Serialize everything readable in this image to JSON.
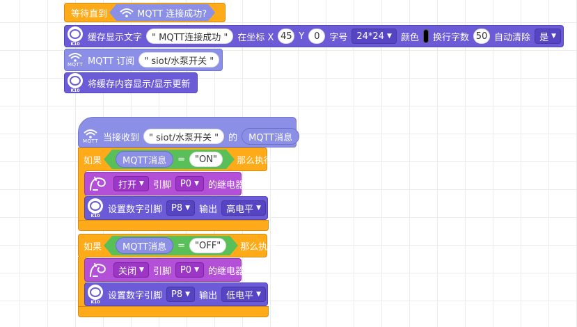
{
  "block_wait": {
    "label": "等待直到",
    "condition": "MQTT 连接成功?"
  },
  "block_cache_text": {
    "label": "缓存显示文字",
    "text": "\" MQTT连接成功 \"",
    "coord_label": "在坐标 X",
    "x": "45",
    "y_label": "Y",
    "y": "0",
    "size_label": "字号",
    "size": "24*24",
    "color_label": "颜色",
    "wrap_label": "换行字数",
    "wrap": "50",
    "autoclear_label": "自动清除",
    "autoclear": "是",
    "board_label": "K10"
  },
  "block_subscribe": {
    "label": "MQTT 订阅",
    "topic": "\" siot/水泵开关 \"",
    "icon_label": "MQTT"
  },
  "block_show_cache": {
    "label": "将缓存内容显示/显示更新",
    "board_label": "K10"
  },
  "hat": {
    "prefix": "当接收到",
    "topic": "\" siot/水泵开关 \"",
    "mid": "的",
    "var": "MQTT消息",
    "icon_label": "MQTT"
  },
  "if1": {
    "if_label": "如果",
    "var": "MQTT消息",
    "eq": "=",
    "value": "\"ON\"",
    "then_label": "那么执行",
    "relay": {
      "action": "打开",
      "pin_label": "引脚",
      "pin": "P0",
      "suffix": "的继电器"
    },
    "digital": {
      "label": "设置数字引脚",
      "pin": "P8",
      "out_label": "输出",
      "level": "高电平",
      "board_label": "K10"
    }
  },
  "if2": {
    "if_label": "如果",
    "var": "MQTT消息",
    "eq": "=",
    "value": "\"OFF\"",
    "then_label": "那么执行",
    "relay": {
      "action": "关闭",
      "pin_label": "引脚",
      "pin": "P0",
      "suffix": "的继电器"
    },
    "digital": {
      "label": "设置数字引脚",
      "pin": "P8",
      "out_label": "输出",
      "level": "低电平",
      "board_label": "K10"
    }
  },
  "colors": {
    "control": "#ffab19",
    "k10": "#6b5bd6",
    "relay": "#b44fd8",
    "mqtt": "#8b8fe6",
    "operator": "#59c059"
  }
}
